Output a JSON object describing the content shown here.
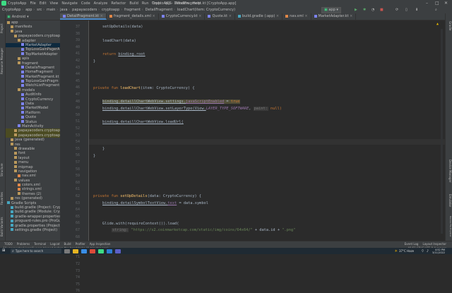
{
  "menubar": {
    "app_name": "CryptoApp",
    "items": [
      "File",
      "Edit",
      "View",
      "Navigate",
      "Code",
      "Analyze",
      "Refactor",
      "Build",
      "Run",
      "Tools",
      "VCS",
      "Window",
      "Help"
    ],
    "window_title": "CryptoApp - DetailFragment.kt [CryptoApp.app]"
  },
  "navbar": {
    "breadcrumbs": [
      "CryptoApp",
      "app",
      "src",
      "main",
      "java",
      "papayacoders",
      "cryptoapp",
      "fragment",
      "DetailFragment",
      "loadChart(item: CryptoCurrency)"
    ],
    "run_config": "app"
  },
  "project_panel": {
    "header": "Android",
    "rows": [
      {
        "label": "app",
        "kind": "fold",
        "indent": 0
      },
      {
        "label": "manifests",
        "kind": "fold",
        "indent": 1
      },
      {
        "label": "java",
        "kind": "fold",
        "indent": 1
      },
      {
        "label": "papayacoders.cryptoapp",
        "kind": "fold",
        "indent": 2
      },
      {
        "label": "adapter",
        "kind": "fold",
        "indent": 3
      },
      {
        "label": "MarketAdapter",
        "kind": "kt",
        "indent": 4,
        "selected": true
      },
      {
        "label": "TopLossGainPagerA",
        "kind": "kt",
        "indent": 4
      },
      {
        "label": "TopMarketAdapter",
        "kind": "kt",
        "indent": 4
      },
      {
        "label": "apis",
        "kind": "fold",
        "indent": 3
      },
      {
        "label": "fragment",
        "kind": "fold",
        "indent": 3
      },
      {
        "label": "DetailsFragment",
        "kind": "kt",
        "indent": 4
      },
      {
        "label": "HomeFragment",
        "kind": "kt",
        "indent": 4
      },
      {
        "label": "MarketFragment.kt",
        "kind": "kt",
        "indent": 4
      },
      {
        "label": "TopLossGainFragm",
        "kind": "kt",
        "indent": 4
      },
      {
        "label": "WatchListFragment",
        "kind": "kt",
        "indent": 4
      },
      {
        "label": "models",
        "kind": "fold",
        "indent": 3
      },
      {
        "label": "AuditInfo",
        "kind": "kt",
        "indent": 4
      },
      {
        "label": "CryptoCurrency",
        "kind": "kt",
        "indent": 4
      },
      {
        "label": "Data",
        "kind": "kt",
        "indent": 4
      },
      {
        "label": "MarketModel",
        "kind": "kt",
        "indent": 4
      },
      {
        "label": "Platform",
        "kind": "kt",
        "indent": 4
      },
      {
        "label": "Quote",
        "kind": "kt",
        "indent": 4
      },
      {
        "label": "Status",
        "kind": "kt",
        "indent": 4
      },
      {
        "label": "MainActivity",
        "kind": "kt",
        "indent": 3
      },
      {
        "label": "papayacoders.cryptoapp",
        "kind": "fold",
        "indent": 2,
        "highlight": true
      },
      {
        "label": "papayacoders.cryptoapp",
        "kind": "fold",
        "indent": 2,
        "highlight": true
      },
      {
        "label": "java (generated)",
        "kind": "fold",
        "indent": 1
      },
      {
        "label": "res",
        "kind": "fold",
        "indent": 1
      },
      {
        "label": "drawable",
        "kind": "fold",
        "indent": 2
      },
      {
        "label": "font",
        "kind": "fold",
        "indent": 2
      },
      {
        "label": "layout",
        "kind": "fold",
        "indent": 2
      },
      {
        "label": "menu",
        "kind": "fold",
        "indent": 2
      },
      {
        "label": "mipmap",
        "kind": "fold",
        "indent": 2
      },
      {
        "label": "navigation",
        "kind": "fold",
        "indent": 2
      },
      {
        "label": "nav.xml",
        "kind": "xm",
        "indent": 3
      },
      {
        "label": "values",
        "kind": "fold",
        "indent": 2
      },
      {
        "label": "colors.xml",
        "kind": "xm",
        "indent": 3
      },
      {
        "label": "strings.xml",
        "kind": "xm",
        "indent": 3
      },
      {
        "label": "themes (2)",
        "kind": "fold",
        "indent": 3
      },
      {
        "label": "res (generated)",
        "kind": "fold",
        "indent": 1
      },
      {
        "label": "Gradle Scripts",
        "kind": "gr",
        "indent": 0
      },
      {
        "label": "build.gradle (Project: CryptoApp)",
        "kind": "gr",
        "indent": 1
      },
      {
        "label": "build.gradle (Module: CryptoApp)",
        "kind": "gr",
        "indent": 1
      },
      {
        "label": "gradle-wrapper.properties",
        "kind": "gr",
        "indent": 1
      },
      {
        "label": "proguard-rules.pro (ProGuard)",
        "kind": "gr",
        "indent": 1
      },
      {
        "label": "gradle.properties (Project)",
        "kind": "gr",
        "indent": 1
      },
      {
        "label": "settings.gradle (Project)",
        "kind": "gr",
        "indent": 1
      }
    ]
  },
  "tabs": [
    {
      "label": "DetailFragment.kt",
      "kind": "kt",
      "active": true
    },
    {
      "label": "fragment_details.xml",
      "kind": "xm"
    },
    {
      "label": "CryptoCurrency.kt",
      "kind": "kt"
    },
    {
      "label": "Quote.kt",
      "kind": "kt"
    },
    {
      "label": "build.gradle (:app)",
      "kind": "gr"
    },
    {
      "label": "nav.xml",
      "kind": "xm"
    },
    {
      "label": "MarketAdapter.kt",
      "kind": "kt"
    }
  ],
  "editor": {
    "line_numbers": [
      "37",
      "38",
      "39",
      "40",
      "41",
      "42",
      "43",
      "44",
      "45",
      "46",
      "47",
      "48",
      "49",
      "50",
      "51",
      "52",
      "53",
      "54",
      "55",
      "56",
      "57",
      "58",
      "59",
      "60",
      "61",
      "62",
      "63",
      "64",
      "65",
      "66",
      "67",
      "68",
      "69",
      "70",
      "71",
      "72",
      "73",
      "74",
      "75",
      "76"
    ],
    "code": {
      "l1": "setUpDetails(data)",
      "l2": "loadChart(data)",
      "l3_kw": "return",
      "l3_rest": "binding.root",
      "l4": "}",
      "l5_kw": "private fun",
      "l5_fn": "loadChart",
      "l5_rest": "(item: CryptoCurrency) {",
      "l6_a": "binding.detaillChartWebView.settings.",
      "l6_b": "javaScriptEnabled",
      "l6_c": " = ",
      "l6_d": "true",
      "l7_a": "binding.detaillChartWebView.setLayerType(View.",
      "l7_b": "LAYER_TYPE_SOFTWARE",
      "l7_c": ", ",
      "l7_hint": "paint:",
      "l7_d": " null)",
      "l8": "binding.detaillChartWebView.loadUrl(",
      "l9": "}",
      "l10": "}",
      "l11_kw": "private fun",
      "l11_fn": "setUpDetails",
      "l11_rest": "(data: CryptoCurrency) {",
      "l12_a": "binding.detailSymbolTextView.",
      "l12_b": "text",
      "l12_c": " = data.symbol",
      "l13": "Glide.with(requireContext()).load(",
      "l14_hint": "string:",
      "l14_str": " \"https://s2.coinmarketcap.com/static/img/coins/64x64/\"",
      "l14_rest": " + data.id + ",
      "l14_str2": "\".png\""
    }
  },
  "bottom_tools": [
    "TODO",
    "Problems",
    "Terminal",
    "Logcat",
    "Build",
    "Profiler",
    "App Inspection",
    "Event Log",
    "Layout Inspector"
  ],
  "status_text": "All unexpected (scroll) were tripped before the handshake (4 minutes ago)",
  "status_right": "46:51  CRLF  UTF-8  4 spaces",
  "taskbar": {
    "search_placeholder": "Type here to search",
    "weather": "37°C  Haze",
    "time": "4:52 PM",
    "date": "3/11/2022"
  },
  "right_tools": [
    "Gradle",
    "Device Manager",
    "Emulator",
    "Device File Explorer"
  ],
  "left_tools": [
    "Project",
    "Resource Manager",
    "Structure",
    "Favorites",
    "Build Variants"
  ],
  "colors": {
    "keyword": "#cc7832",
    "function": "#ffc66d",
    "property": "#9876aa",
    "string": "#6a8759",
    "text": "#a9b7c6"
  }
}
